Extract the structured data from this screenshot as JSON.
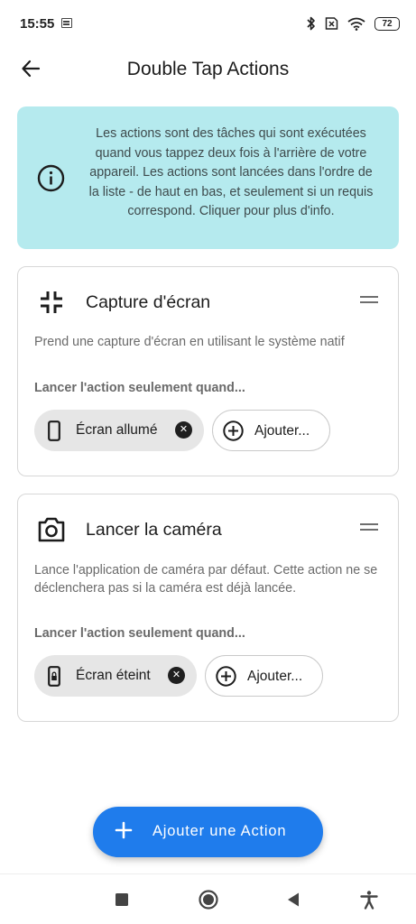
{
  "status_bar": {
    "time": "15:55",
    "battery": "72",
    "icons": [
      "gallery-icon",
      "bluetooth-icon",
      "no-sim-icon",
      "wifi-icon",
      "battery-icon"
    ]
  },
  "app_bar": {
    "title": "Double Tap Actions",
    "back_icon": "arrow-left-icon"
  },
  "info_banner": {
    "icon": "info-circle-icon",
    "text": "Les actions sont des tâches qui sont exécutées quand vous tappez deux fois à l'arrière de votre appareil. Les actions sont lancées dans l'ordre de la liste - de haut en bas, et seulement si un requis correspond. Cliquer pour plus d'info."
  },
  "actions": [
    {
      "icon": "screenshot-icon",
      "title": "Capture d'écran",
      "description": "Prend une capture d'écran en utilisant le système natif",
      "requirement_label": "Lancer l'action seulement quand...",
      "condition": {
        "icon": "phone-icon",
        "label": "Écran allumé"
      },
      "add_label": "Ajouter..."
    },
    {
      "icon": "camera-icon",
      "title": "Lancer la caméra",
      "description": "Lance l'application de caméra par défaut. Cette action ne se déclenchera pas si la caméra est déjà lancée.",
      "requirement_label": "Lancer l'action seulement quand...",
      "condition": {
        "icon": "phone-lock-icon",
        "label": "Écran éteint"
      },
      "add_label": "Ajouter..."
    }
  ],
  "fab": {
    "label": "Ajouter une Action",
    "icon": "plus-icon"
  },
  "nav_bar": {
    "buttons": [
      "recents-icon",
      "home-icon",
      "back-icon",
      "accessibility-icon"
    ]
  },
  "colors": {
    "banner_bg": "#b5eaee",
    "fab_bg": "#1f7cec",
    "chip_bg": "#e6e6e6"
  }
}
